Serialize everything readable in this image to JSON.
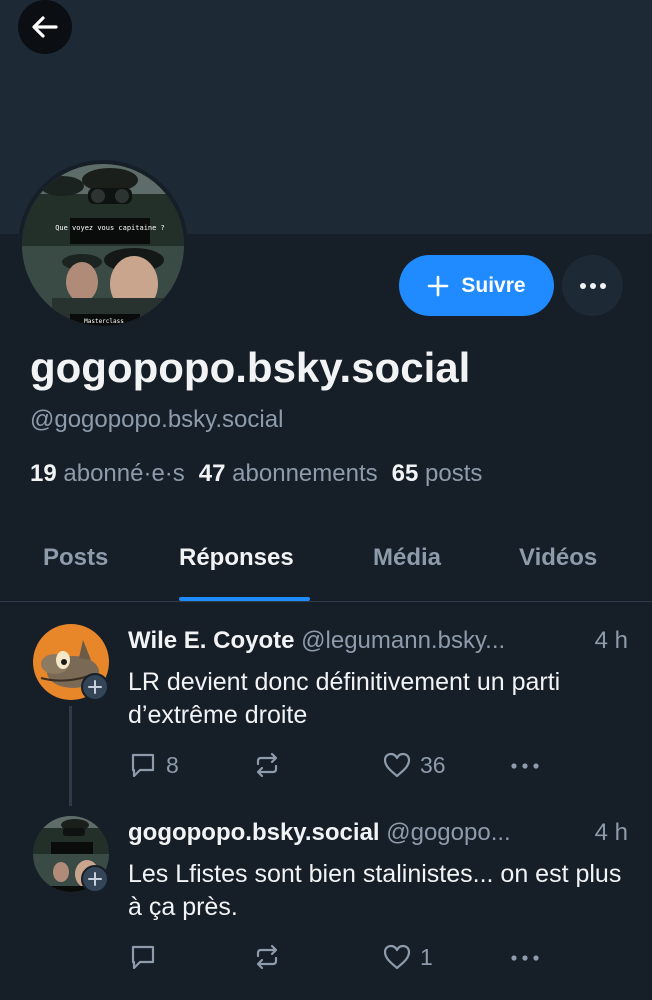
{
  "profile": {
    "display_name": "gogopopo.bsky.social",
    "handle": "@gogopopo.bsky.social",
    "follow_label": "Suivre",
    "avatar_caption_top": "Que voyez vous capitaine ?",
    "avatar_caption_bottom": "Masterclass"
  },
  "stats": {
    "followers_count": "19",
    "followers_label": "abonné·e·s",
    "following_count": "47",
    "following_label": "abonnements",
    "posts_count": "65",
    "posts_label": "posts"
  },
  "tabs": [
    {
      "label": "Posts",
      "active": false
    },
    {
      "label": "Réponses",
      "active": true
    },
    {
      "label": "Média",
      "active": false
    },
    {
      "label": "Vidéos",
      "active": false
    }
  ],
  "posts": [
    {
      "author": "Wile E. Coyote",
      "handle": "@legumann.bsky...",
      "time": "4 h",
      "text": "LR devient donc définitivement un parti d’extrême droite",
      "replies": "8",
      "reposts": "",
      "likes": "36"
    },
    {
      "author": "gogopopo.bsky.social",
      "handle": "@gogopo...",
      "time": "4 h",
      "text": "Les Lfistes sont bien stalinistes... on est plus à ça près.",
      "replies": "",
      "reposts": "",
      "likes": "1"
    }
  ],
  "icons": {
    "back": "arrow-left-icon",
    "plus": "plus-icon",
    "more": "ellipsis-icon",
    "reply": "comment-icon",
    "repost": "repost-icon",
    "like": "heart-icon"
  },
  "colors": {
    "background": "#161e27",
    "banner": "#1e2936",
    "accent": "#208bfe",
    "muted_text": "#8d9bab"
  }
}
